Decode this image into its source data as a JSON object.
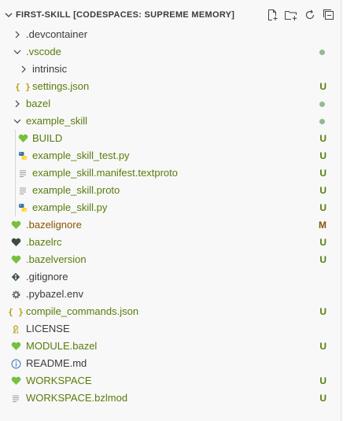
{
  "header": {
    "title": "FIRST-SKILL [CODESPACES: SUPREME MEMORY]",
    "actions": [
      "new-file-icon",
      "new-folder-icon",
      "refresh-icon",
      "collapse-all-icon"
    ]
  },
  "colors": {
    "untracked": "#587c0c",
    "modified": "#895503",
    "default": "#3b3b3b",
    "dot": "#8fbc8f",
    "bazel_heart": "#76c03e",
    "dark_heart": "#3e4b40",
    "json_brace": "#b5a10a",
    "python_blue": "#3572A5",
    "python_yellow": "#ffd43b",
    "info_blue": "#4a7ec0"
  },
  "tree": [
    {
      "label": ".devcontainer",
      "kind": "folder",
      "expanded": false,
      "depth": 1,
      "status": ""
    },
    {
      "label": ".vscode",
      "kind": "folder",
      "expanded": true,
      "depth": 1,
      "status": "dot"
    },
    {
      "label": "intrinsic",
      "kind": "folder",
      "expanded": false,
      "depth": 2,
      "status": ""
    },
    {
      "label": "settings.json",
      "kind": "json",
      "depth": 2,
      "status": "U"
    },
    {
      "label": "bazel",
      "kind": "folder",
      "expanded": false,
      "depth": 1,
      "status": "dot"
    },
    {
      "label": "example_skill",
      "kind": "folder",
      "expanded": true,
      "depth": 1,
      "status": "dot"
    },
    {
      "label": "BUILD",
      "kind": "bazel",
      "depth": 2,
      "status": "U"
    },
    {
      "label": "example_skill_test.py",
      "kind": "python",
      "depth": 2,
      "status": "U"
    },
    {
      "label": "example_skill.manifest.textproto",
      "kind": "text",
      "depth": 2,
      "status": "U"
    },
    {
      "label": "example_skill.proto",
      "kind": "text",
      "depth": 2,
      "status": "U"
    },
    {
      "label": "example_skill.py",
      "kind": "python",
      "depth": 2,
      "status": "U"
    },
    {
      "label": ".bazelignore",
      "kind": "bazel",
      "depth": 0,
      "status": "M"
    },
    {
      "label": ".bazelrc",
      "kind": "bazel-dark",
      "depth": 0,
      "status": "U"
    },
    {
      "label": ".bazelversion",
      "kind": "bazel",
      "depth": 0,
      "status": "U"
    },
    {
      "label": ".gitignore",
      "kind": "git",
      "depth": 0,
      "status": ""
    },
    {
      "label": ".pybazel.env",
      "kind": "gear",
      "depth": 0,
      "status": ""
    },
    {
      "label": "compile_commands.json",
      "kind": "json",
      "depth": 0,
      "status": "U"
    },
    {
      "label": "LICENSE",
      "kind": "license",
      "depth": 0,
      "status": ""
    },
    {
      "label": "MODULE.bazel",
      "kind": "bazel",
      "depth": 0,
      "status": "U"
    },
    {
      "label": "README.md",
      "kind": "info",
      "depth": 0,
      "status": ""
    },
    {
      "label": "WORKSPACE",
      "kind": "bazel",
      "depth": 0,
      "status": "U"
    },
    {
      "label": "WORKSPACE.bzlmod",
      "kind": "text",
      "depth": 0,
      "status": "U"
    }
  ]
}
